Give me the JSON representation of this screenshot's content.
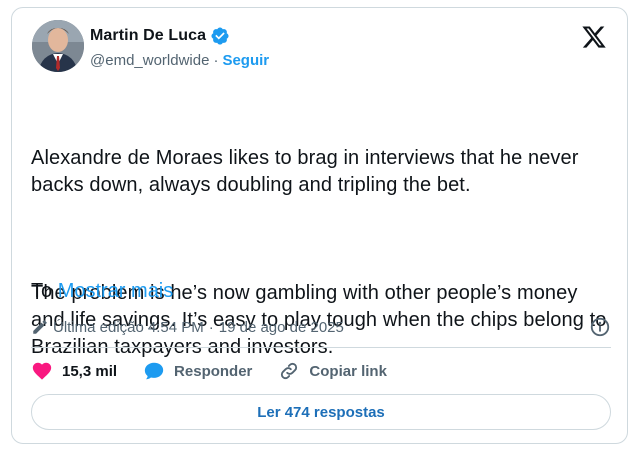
{
  "author": {
    "display_name": "Martin De Luca",
    "handle": "@emd_worldwide",
    "separator": "·",
    "follow_label": "Seguir",
    "verified_icon": "verified-badge-icon",
    "avatar_icon": "profile-photo"
  },
  "platform_icon": "x-logo-icon",
  "tweet": {
    "paragraph_1": "Alexandre de Moraes likes to brag in interviews that he never backs down, always doubling and tripling the bet.",
    "paragraph_2": "The problem is he’s now gambling with other people’s money and life savings. It’s easy to play tough when the chips belong to Brazilian taxpayers and investors.",
    "truncated_start": "To",
    "show_more_label": "Mostrar mais"
  },
  "meta": {
    "edit_prefix": "Última edição",
    "time": "4:54 PM",
    "separator": "·",
    "date": "19 de ago de 2025",
    "edit_icon": "pencil-icon",
    "info_icon": "info-icon"
  },
  "actions": {
    "like_count": "15,3 mil",
    "reply_label": "Responder",
    "copy_link_label": "Copiar link"
  },
  "replies_button": {
    "label": "Ler 474 respostas"
  },
  "colors": {
    "accent": "#1d9bf0",
    "like": "#f91880",
    "muted_text": "#536471",
    "border": "#cfd9de"
  }
}
